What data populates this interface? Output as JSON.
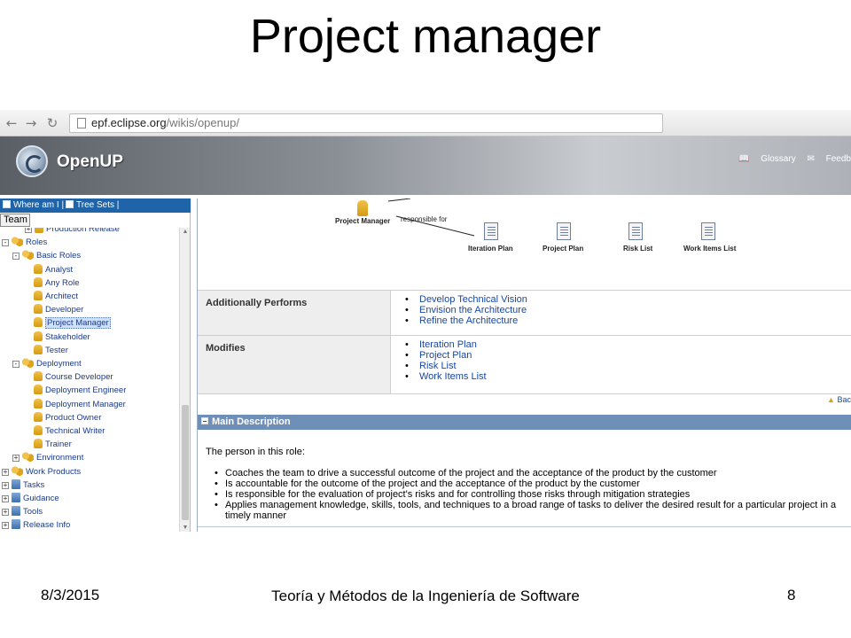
{
  "slide": {
    "title": "Project manager",
    "footer_date": "8/3/2015",
    "footer_center": "Teoría y Métodos de la Ingeniería de Software",
    "page_number": "8"
  },
  "browser": {
    "url_host": "epf.eclipse.org",
    "url_path": "/wikis/openup/"
  },
  "banner": {
    "logo_text": "OpenUP",
    "links": [
      "Glossary",
      "Feedb"
    ]
  },
  "left_panel": {
    "tabs": [
      "Where am I",
      "Tree Sets"
    ],
    "view_selector": "Team",
    "tree": [
      {
        "label": "Production Release",
        "level": 3,
        "expander": "+",
        "icon": "role"
      },
      {
        "label": "Roles",
        "level": 0,
        "expander": "-",
        "icon": "group"
      },
      {
        "label": "Basic Roles",
        "level": 1,
        "expander": "-",
        "icon": "group"
      },
      {
        "label": "Analyst",
        "level": 2,
        "icon": "role"
      },
      {
        "label": "Any Role",
        "level": 2,
        "icon": "role"
      },
      {
        "label": "Architect",
        "level": 2,
        "icon": "role"
      },
      {
        "label": "Developer",
        "level": 2,
        "icon": "role"
      },
      {
        "label": "Project Manager",
        "level": 2,
        "icon": "role",
        "selected": true
      },
      {
        "label": "Stakeholder",
        "level": 2,
        "icon": "role"
      },
      {
        "label": "Tester",
        "level": 2,
        "icon": "role"
      },
      {
        "label": "Deployment",
        "level": 1,
        "expander": "-",
        "icon": "group"
      },
      {
        "label": "Course Developer",
        "level": 2,
        "icon": "role"
      },
      {
        "label": "Deployment Engineer",
        "level": 2,
        "icon": "role"
      },
      {
        "label": "Deployment Manager",
        "level": 2,
        "icon": "role"
      },
      {
        "label": "Product Owner",
        "level": 2,
        "icon": "role"
      },
      {
        "label": "Technical Writer",
        "level": 2,
        "icon": "role"
      },
      {
        "label": "Trainer",
        "level": 2,
        "icon": "role"
      },
      {
        "label": "Environment",
        "level": 1,
        "expander": "+",
        "icon": "group"
      },
      {
        "label": "Work Products",
        "level": 0,
        "expander": "+",
        "icon": "group"
      },
      {
        "label": "Tasks",
        "level": 0,
        "expander": "+",
        "icon": "folder"
      },
      {
        "label": "Guidance",
        "level": 0,
        "expander": "+",
        "icon": "folder"
      },
      {
        "label": "Tools",
        "level": 0,
        "expander": "+",
        "icon": "folder"
      },
      {
        "label": "Release Info",
        "level": 0,
        "expander": "+",
        "icon": "folder"
      }
    ]
  },
  "content": {
    "diagram": {
      "role_label": "Project Manager",
      "relation_label": "responsible for",
      "artifacts": [
        "Iteration Plan",
        "Project Plan",
        "Risk List",
        "Work Items List"
      ]
    },
    "additionally_performs": {
      "header": "Additionally Performs",
      "items": [
        "Develop Technical Vision",
        "Envision the Architecture",
        "Refine the Architecture"
      ]
    },
    "modifies": {
      "header": "Modifies",
      "items": [
        "Iteration Plan",
        "Project Plan",
        "Risk List",
        "Work Items List"
      ]
    },
    "back_link": "Bac",
    "main_description": {
      "header": "Main Description",
      "intro": "The person in this role:",
      "bullets": [
        "Coaches the team to drive a successful outcome of the project and the acceptance of the product by the customer",
        "Is accountable for the outcome of the project and the acceptance of the product by the customer",
        "Is responsible for the evaluation of project's risks and for controlling those risks through mitigation strategies",
        "Applies management knowledge, skills, tools, and techniques to a broad range of tasks to deliver the desired result for a particular project in a timely manner"
      ]
    }
  }
}
